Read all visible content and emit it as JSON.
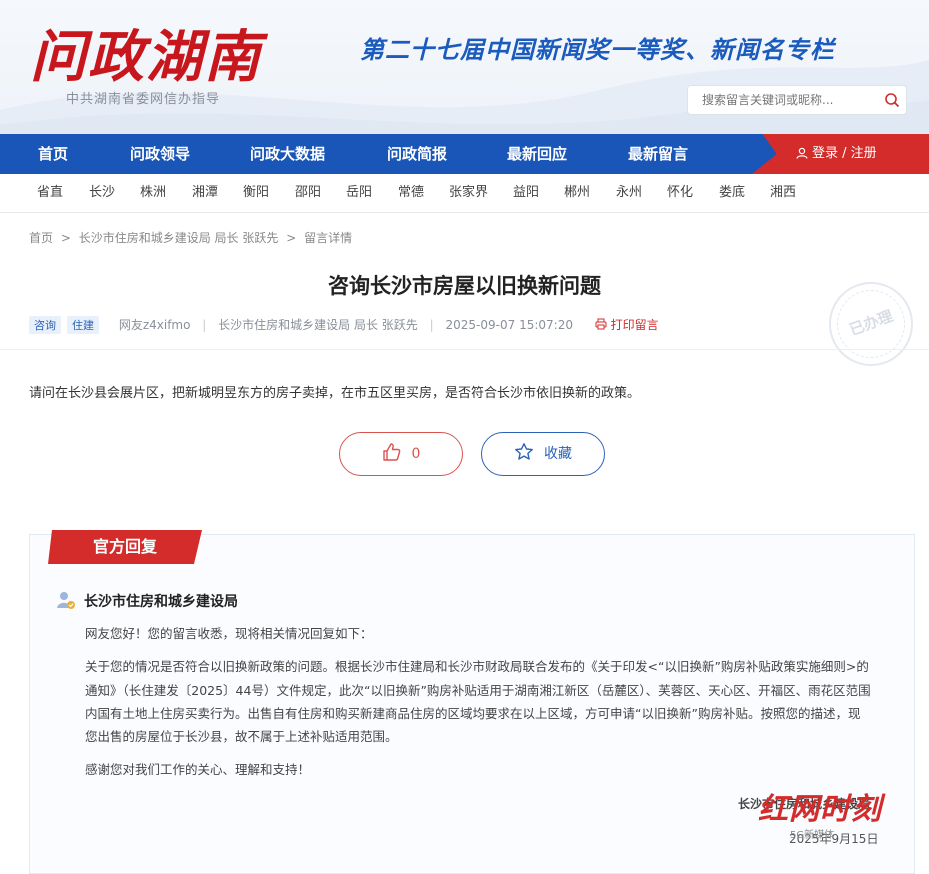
{
  "header": {
    "logo": "问政湖南",
    "slogan": "第二十七届中国新闻奖一等奖、新闻名专栏",
    "guide": "中共湖南省委网信办指导",
    "search_placeholder": "搜索留言关键词或昵称..."
  },
  "nav": {
    "items": [
      "首页",
      "问政领导",
      "问政大数据",
      "问政简报",
      "最新回应",
      "最新留言"
    ],
    "login": "登录 / 注册"
  },
  "subnav": {
    "items": [
      "省直",
      "长沙",
      "株洲",
      "湘潭",
      "衡阳",
      "邵阳",
      "岳阳",
      "常德",
      "张家界",
      "益阳",
      "郴州",
      "永州",
      "怀化",
      "娄底",
      "湘西"
    ]
  },
  "breadcrumb": [
    "首页",
    ">",
    "长沙市住房和城乡建设局 局长 张跃先",
    ">",
    "留言详情"
  ],
  "post": {
    "title": "咨询长沙市房屋以旧换新问题",
    "tags": [
      "咨询",
      "住建"
    ],
    "author": "网友z4xifmo",
    "target": "长沙市住房和城乡建设局 局长 张跃先",
    "time": "2025-09-07 15:07:20",
    "print": "打印留言",
    "status_stamp": "已办理",
    "content": "请问在长沙县会展片区，把新城明昱东方的房子卖掉，在市五区里买房，是否符合长沙市依旧换新的政策。",
    "likes": "0",
    "favorite": "收藏"
  },
  "reply": {
    "label": "官方回复",
    "org": "长沙市住房和城乡建设局",
    "greeting": "网友您好！您的留言收悉，现将相关情况回复如下：",
    "lines": [
      "关于您的情况是否符合以旧换新政策的问题。根据长沙市住建局和长沙市财政局联合发布的《关于印发<“以旧换新”购房补贴政策实施细则>的",
      "通知》（长住建发〔2025〕44号）文件规定，此次“以旧换新”购房补贴适用于湖南湘江新区（岳麓区）、芙蓉区、天心区、开福区、雨花区范围",
      "内国有土地上住房买卖行为。出售自有住房和购买新建商品住房的区域均要求在以上区域，方可申请“以旧换新”购房补贴。按照您的描述，现",
      "您出售的房屋位于长沙县，故不属于上述补贴适用范围。"
    ],
    "thanks": "感谢您对我们工作的关心、理解和支持！",
    "signature": "长沙市住房和城乡建设局",
    "date": "2025年9月15日"
  },
  "watermark": {
    "text": "红网时刻",
    "sub": "5G新媒体"
  },
  "colors": {
    "brand_red": "#d42b2b",
    "nav_blue": "#1a55b8"
  }
}
